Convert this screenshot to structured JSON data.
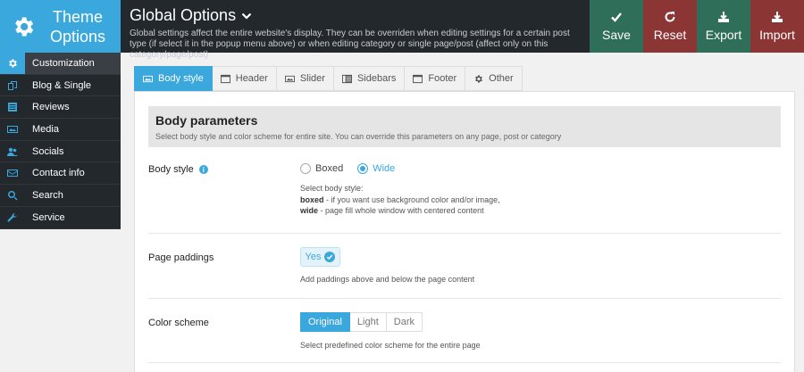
{
  "app": {
    "logo_line1": "Theme",
    "logo_line2": "Options",
    "page_title": "Global Options",
    "page_desc": "Global settings affect the entire website's display. They can be overriden when editing settings for a certain post type (if select it in the popup menu above) or when editing category or single page/post (affect only on this category/page/post)"
  },
  "actions": {
    "save": "Save",
    "reset": "Reset",
    "export": "Export",
    "import": "Import"
  },
  "sidebar": {
    "items": [
      {
        "label": "Customization",
        "icon": "gear-icon"
      },
      {
        "label": "Blog & Single",
        "icon": "copy-icon"
      },
      {
        "label": "Reviews",
        "icon": "list-icon"
      },
      {
        "label": "Media",
        "icon": "image-icon"
      },
      {
        "label": "Socials",
        "icon": "users-icon"
      },
      {
        "label": "Contact info",
        "icon": "envelope-icon"
      },
      {
        "label": "Search",
        "icon": "search-icon"
      },
      {
        "label": "Service",
        "icon": "wrench-icon"
      }
    ]
  },
  "tabs": [
    {
      "label": "Body style",
      "icon": "image-icon"
    },
    {
      "label": "Header",
      "icon": "window-icon"
    },
    {
      "label": "Slider",
      "icon": "image-icon"
    },
    {
      "label": "Sidebars",
      "icon": "columns-icon"
    },
    {
      "label": "Footer",
      "icon": "window-icon"
    },
    {
      "label": "Other",
      "icon": "gear-icon"
    }
  ],
  "section": {
    "title": "Body parameters",
    "desc": "Select body style and color scheme for entire site. You can override this parameters on any page, post or category"
  },
  "body_style": {
    "label": "Body style",
    "options": [
      "Boxed",
      "Wide"
    ],
    "selected": "Wide",
    "help_intro": "Select body style:",
    "help_boxed_key": "boxed",
    "help_boxed_text": " - if you want use background color and/or image,",
    "help_wide_key": "wide",
    "help_wide_text": " - page fill whole window with centered content"
  },
  "page_paddings": {
    "label": "Page paddings",
    "value": "Yes",
    "help": "Add paddings above and below the page content"
  },
  "color_scheme": {
    "label": "Color scheme",
    "options": [
      "Original",
      "Light",
      "Dark"
    ],
    "selected": "Original",
    "help": "Select predefined color scheme for the entire page"
  },
  "colors": {
    "accent": "#3aa7dd",
    "dark": "#23282d",
    "save_green": "#2f6e58",
    "reset_red": "#8c3535"
  }
}
